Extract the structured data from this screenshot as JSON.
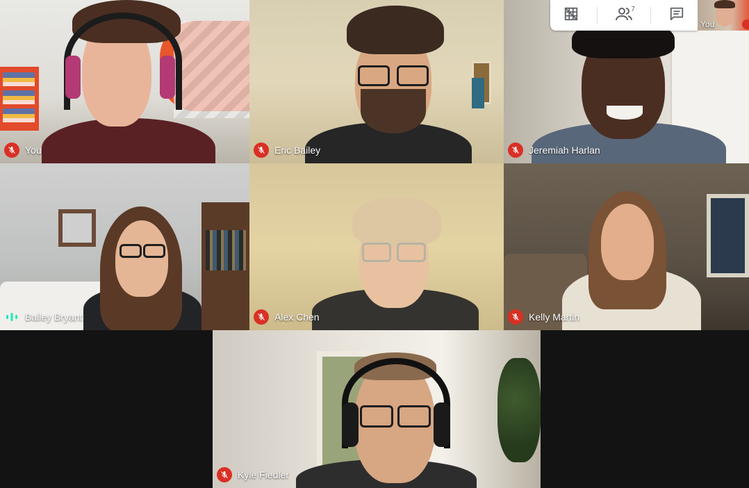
{
  "participants": [
    {
      "name": "You",
      "mic": "muted"
    },
    {
      "name": "Eric Bailey",
      "mic": "muted"
    },
    {
      "name": "Jeremiah Harlan",
      "mic": "muted"
    },
    {
      "name": "Bailey Bryant",
      "mic": "speaking"
    },
    {
      "name": "Alex Chen",
      "mic": "muted"
    },
    {
      "name": "Kelly Martin",
      "mic": "muted"
    },
    {
      "name": "Kyle Fiedler",
      "mic": "muted"
    }
  ],
  "controls": {
    "layout_icon": "grid-icon",
    "people_icon": "people-icon",
    "people_count": "7",
    "chat_icon": "chat-icon"
  },
  "self_view": {
    "label": "You"
  },
  "colors": {
    "muted_red": "#d93025",
    "speaking_teal": "#1de9b6"
  }
}
